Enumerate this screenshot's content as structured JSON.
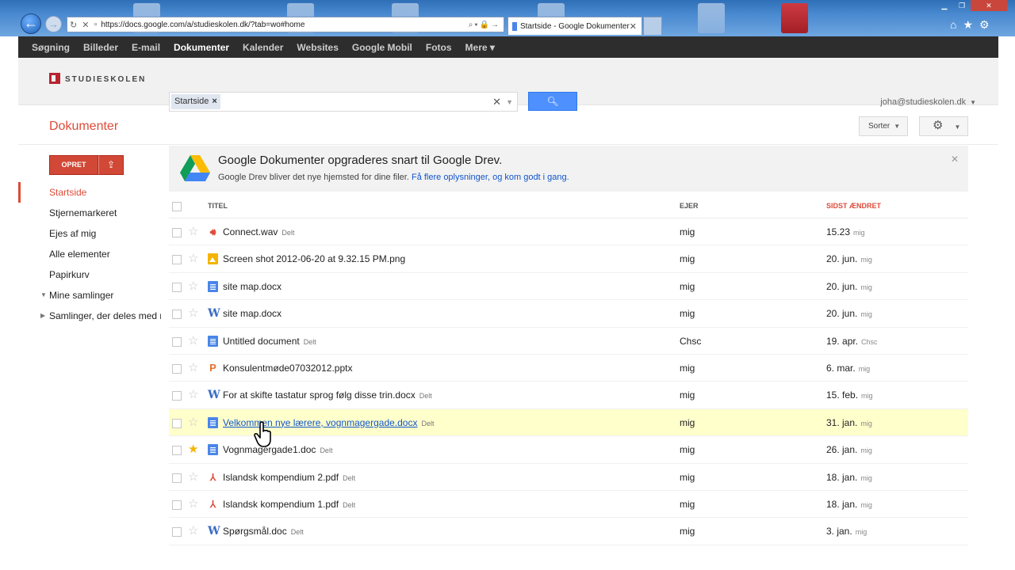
{
  "browser": {
    "url": "https://docs.google.com/a/studieskolen.dk/?tab=wo#home",
    "tab_title": "Startside - Google Dokumenter",
    "back_icon": "arrow-left-icon",
    "accent": "#2f6fb7"
  },
  "gbar": {
    "items": [
      "Søgning",
      "Billeder",
      "E-mail",
      "Dokumenter",
      "Kalender",
      "Websites",
      "Google Mobil",
      "Fotos",
      "Mere ▾"
    ],
    "active": "Dokumenter"
  },
  "header": {
    "logo_text": "STUDIESKOLEN",
    "search_chip": "Startside",
    "account": "joha@studieskolen.dk"
  },
  "title": {
    "page_title": "Dokumenter",
    "sort_label": "Sorter"
  },
  "sidebar": {
    "create_label": "OPRET",
    "items": [
      {
        "label": "Startside",
        "active": true
      },
      {
        "label": "Stjernemarkeret"
      },
      {
        "label": "Ejes af mig"
      },
      {
        "label": "Alle elementer"
      },
      {
        "label": "Papirkurv"
      },
      {
        "label": "Mine samlinger",
        "tree": "expanded"
      },
      {
        "label": "Samlinger, der deles med mig",
        "tree": "collapsed"
      }
    ]
  },
  "notice": {
    "heading": "Google Dokumenter opgraderes snart til Google Drev.",
    "text": "Google Drev bliver det nye hjemsted for dine filer.",
    "link": "Få flere oplysninger, og kom godt i gang."
  },
  "table": {
    "headers": {
      "title": "TITEL",
      "owner": "EJER",
      "modified": "SIDST ÆNDRET"
    },
    "sorted_color": "#dd4b39",
    "rows": [
      {
        "icon": "audio",
        "name": "Connect.wav",
        "shared": "Delt",
        "owner": "mig",
        "date": "15.23",
        "by": "mig",
        "starred": false
      },
      {
        "icon": "image",
        "name": "Screen shot 2012-06-20 at 9.32.15 PM.png",
        "shared": "",
        "owner": "mig",
        "date": "20. jun.",
        "by": "mig",
        "starred": false
      },
      {
        "icon": "doc",
        "name": "site map.docx",
        "shared": "",
        "owner": "mig",
        "date": "20. jun.",
        "by": "mig",
        "starred": false
      },
      {
        "icon": "word",
        "name": "site map.docx",
        "shared": "",
        "owner": "mig",
        "date": "20. jun.",
        "by": "mig",
        "starred": false
      },
      {
        "icon": "doc",
        "name": "Untitled document",
        "shared": "Delt",
        "owner": "Chsc",
        "date": "19. apr.",
        "by": "Chsc",
        "starred": false
      },
      {
        "icon": "ppt",
        "name": "Konsulentmøde07032012.pptx",
        "shared": "",
        "owner": "mig",
        "date": "6. mar.",
        "by": "mig",
        "starred": false
      },
      {
        "icon": "word",
        "name": "For at skifte tastatur sprog følg disse trin.docx",
        "shared": "Delt",
        "owner": "mig",
        "date": "15. feb.",
        "by": "mig",
        "starred": false
      },
      {
        "icon": "doc",
        "name": "Velkommen nye lærere, vognmagergade.docx",
        "shared": "Delt",
        "owner": "mig",
        "date": "31. jan.",
        "by": "mig",
        "starred": false,
        "hover": true
      },
      {
        "icon": "doc",
        "name": "Vognmagergade1.doc",
        "shared": "Delt",
        "owner": "mig",
        "date": "26. jan.",
        "by": "mig",
        "starred": true
      },
      {
        "icon": "pdf",
        "name": "Islandsk kompendium 2.pdf",
        "shared": "Delt",
        "owner": "mig",
        "date": "18. jan.",
        "by": "mig",
        "starred": false
      },
      {
        "icon": "pdf",
        "name": "Islandsk kompendium 1.pdf",
        "shared": "Delt",
        "owner": "mig",
        "date": "18. jan.",
        "by": "mig",
        "starred": false
      },
      {
        "icon": "word",
        "name": "Spørgsmål.doc",
        "shared": "Delt",
        "owner": "mig",
        "date": "3. jan.",
        "by": "mig",
        "starred": false
      }
    ]
  }
}
